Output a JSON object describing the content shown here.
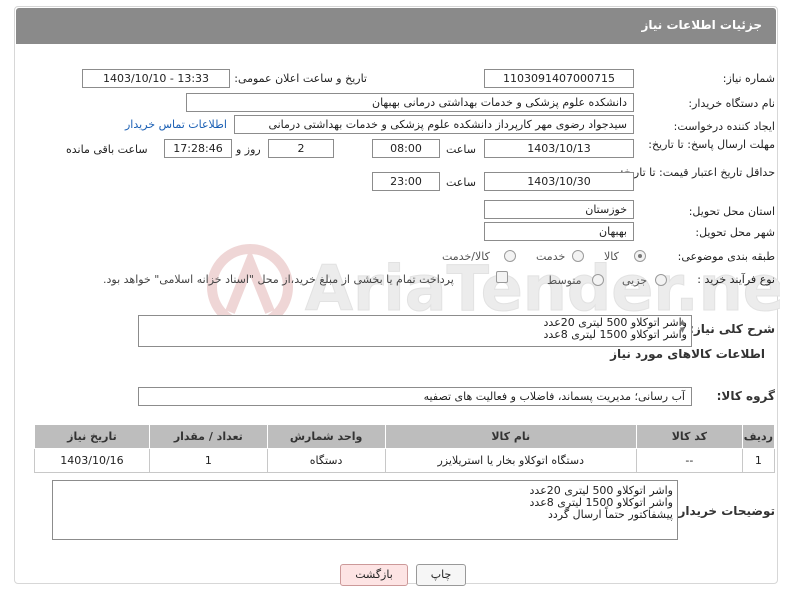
{
  "header": {
    "title": "جزئیات اطلاعات نیاز"
  },
  "fields": {
    "need_number": {
      "label": "شماره نیاز:",
      "value": "1103091407000715"
    },
    "announce_datetime": {
      "label": "تاریخ و ساعت اعلان عمومی:",
      "value": "1403/10/10 - 13:33"
    },
    "buyer_org": {
      "label": "نام دستگاه خریدار:",
      "value": "دانشکده علوم پزشکی و خدمات بهداشتی  درمانی بهبهان"
    },
    "requester": {
      "label": "ایجاد کننده درخواست:",
      "value": "سیدجواد رضوی مهر کارپرداز دانشکده علوم پزشکی و خدمات بهداشتی  درمانی",
      "contact_link": "اطلاعات تماس خریدار"
    },
    "reply_deadline": {
      "label": "مهلت ارسال پاسخ: تا تاریخ:",
      "date": "1403/10/13",
      "time_label": "ساعت",
      "time": "08:00",
      "days": "2",
      "days_label": "روز و",
      "remaining": "17:28:46",
      "remaining_label": "ساعت باقی مانده"
    },
    "price_validity": {
      "label": "حداقل تاریخ اعتبار قیمت: تا تاریخ:",
      "date": "1403/10/30",
      "time_label": "ساعت",
      "time": "23:00"
    },
    "province": {
      "label": "استان محل تحویل:",
      "value": "خوزستان"
    },
    "city": {
      "label": "شهر محل تحویل:",
      "value": "بهبهان"
    },
    "category": {
      "label": "طبقه بندی موضوعی:",
      "options": [
        "کالا",
        "خدمت",
        "کالا/خدمت"
      ],
      "selected": "کالا"
    },
    "process_type": {
      "label": "نوع فرآیند خرید :",
      "options": [
        "جزیی",
        "متوسط"
      ],
      "payment_note": "پرداخت تمام یا بخشی از مبلغ خرید،از محل \"اسناد خزانه اسلامی\" خواهد بود."
    }
  },
  "summary": {
    "label": "شرح کلی نیاز:",
    "lines": [
      "واشر اتوکلاو 500 لیتری 20عدد",
      "واشر اتوکلاو 1500 لیتری 8عدد"
    ]
  },
  "goods_section": {
    "title": "اطلاعات کالاهای مورد نیاز"
  },
  "goods_group": {
    "label": "گروه کالا:",
    "value": "آب رسانی؛ مدیریت پسماند، فاضلاب و فعالیت های تصفیه"
  },
  "table": {
    "headers": [
      "ردیف",
      "کد کالا",
      "نام کالا",
      "واحد شمارش",
      "تعداد / مقدار",
      "تاریخ نیاز"
    ],
    "rows": [
      [
        "1",
        "--",
        "دستگاه اتوکلاو بخار یا استریلایزر",
        "دستگاه",
        "1",
        "1403/10/16"
      ]
    ]
  },
  "buyer_notes": {
    "label": "توضیحات خریدار:",
    "lines": [
      "واشر اتوکلاو 500 لیتری 20عدد",
      "واشر اتوکلاو 1500 لیتری 8عدد",
      "پیشفاکتور حتماً ارسال گردد"
    ]
  },
  "buttons": {
    "print": "چاپ",
    "back": "بازگشت"
  },
  "watermark": {
    "text": "AriaTender.neT"
  },
  "colors": {
    "header_bg": "#8a8a8a",
    "link": "#1a5fb4",
    "table_header": "#bdbdbd",
    "back_btn": "#fde4e4"
  }
}
